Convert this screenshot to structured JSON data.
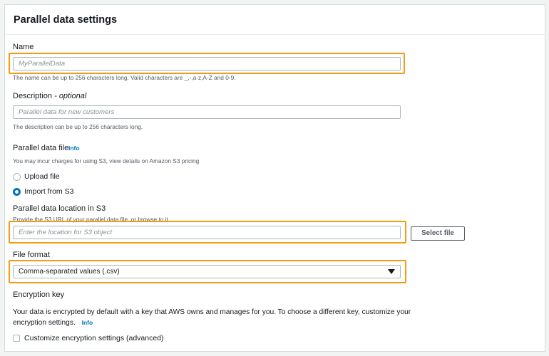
{
  "panel": {
    "title": "Parallel data settings"
  },
  "name_field": {
    "label": "Name",
    "placeholder": "MyParallelData",
    "hint": "The name can be up to 256 characters long. Valid characters are _,-,a-z,A-Z and 0-9."
  },
  "description_field": {
    "label": "Description",
    "label_optional": "- optional",
    "placeholder": "Parallel data for new customers",
    "hint": "The description can be up to 256 characters long."
  },
  "data_file": {
    "label": "Parallel data file",
    "info": "Info",
    "hint": "You may incur charges for using S3, view details on Amazon S3 pricing",
    "options": [
      {
        "label": "Upload file",
        "selected": false
      },
      {
        "label": "Import from S3",
        "selected": true
      }
    ]
  },
  "s3_location": {
    "label": "Parallel data location in S3",
    "hint": "Provide the S3 URL of your parallel data file, or browse to it.",
    "placeholder": "Enter the location for S3 object",
    "button": "Select file"
  },
  "file_format": {
    "label": "File format",
    "value": "Comma-separated values (.csv)"
  },
  "encryption": {
    "label": "Encryption key",
    "text": "Your data is encrypted by default with a key that AWS owns and manages for you. To choose a different key, customize your encryption settings.",
    "info": "Info",
    "checkbox_label": "Customize encryption settings (advanced)",
    "checkbox_checked": false
  },
  "colors": {
    "highlight": "#f59a12",
    "link": "#0073bb",
    "radio_selected": "#0073bb"
  },
  "icons": {
    "select_caret": "caret-down-icon"
  }
}
